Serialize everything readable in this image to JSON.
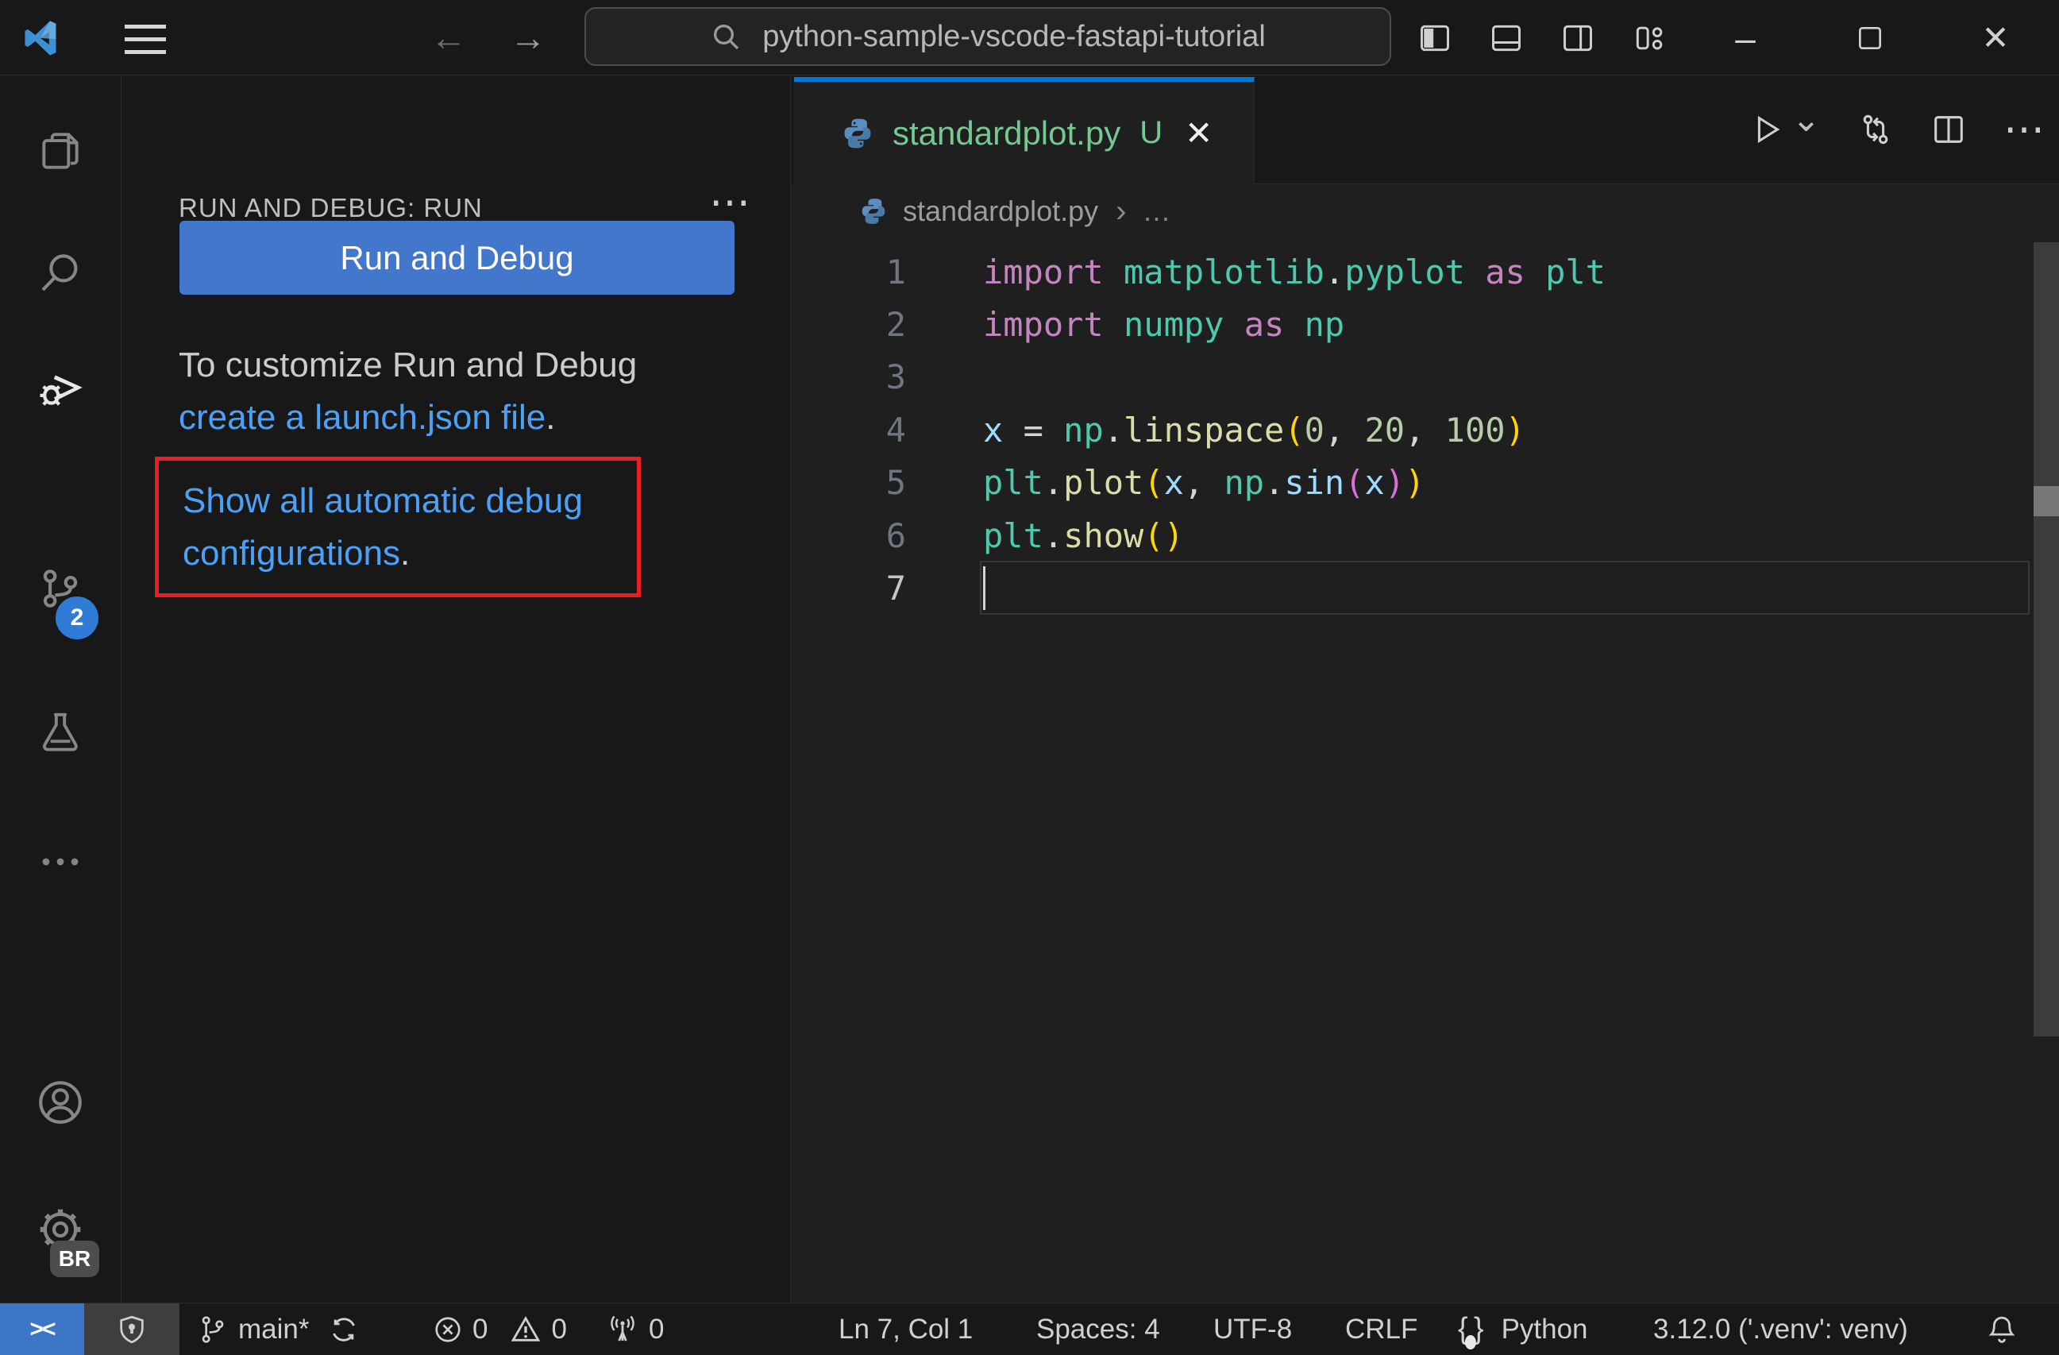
{
  "titlebar": {
    "search_value": "python-sample-vscode-fastapi-tutorial",
    "back_glyph": "←",
    "forward_glyph": "→",
    "minimize_glyph": "–",
    "close_glyph": "✕"
  },
  "activitybar": {
    "scm_badge": "2",
    "settings_badge": "BR"
  },
  "sidebar": {
    "header": "RUN AND DEBUG: RUN",
    "more_glyph": "⋯",
    "run_button": "Run and Debug",
    "hint_line1": "To customize Run and Debug",
    "hint_link": "create a launch.json file",
    "hint_period": ".",
    "box_link_line1": "Show all automatic debug",
    "box_link_line2": "configurations",
    "box_period": "."
  },
  "editor": {
    "tab": {
      "filename": "standardplot.py",
      "badge": "U",
      "close_glyph": "✕"
    },
    "toolbar": {
      "chevron_glyph": "⌄",
      "more_glyph": "⋯"
    },
    "breadcrumb": {
      "file": "standardplot.py",
      "separator": "›",
      "more": "…"
    },
    "code": {
      "active_line": 7,
      "colors": {
        "kw": "#C586C0",
        "mod": "#4EC9B0",
        "fn": "#DCDCAA",
        "var": "#9CDCFE",
        "num": "#B5CEA8",
        "pl": "#D4D4D4",
        "b1": "#FFD700",
        "b2": "#DA70D6"
      },
      "lines": [
        [
          [
            "import",
            "kw"
          ],
          [
            " ",
            "pl"
          ],
          [
            "matplotlib",
            "mod"
          ],
          [
            ".",
            "pl"
          ],
          [
            "pyplot",
            "mod"
          ],
          [
            " ",
            "pl"
          ],
          [
            "as",
            "kw"
          ],
          [
            " ",
            "pl"
          ],
          [
            "plt",
            "mod"
          ]
        ],
        [
          [
            "import",
            "kw"
          ],
          [
            " ",
            "pl"
          ],
          [
            "numpy",
            "mod"
          ],
          [
            " ",
            "pl"
          ],
          [
            "as",
            "kw"
          ],
          [
            " ",
            "pl"
          ],
          [
            "np",
            "mod"
          ]
        ],
        [],
        [
          [
            "x",
            "var"
          ],
          [
            " = ",
            "pl"
          ],
          [
            "np",
            "mod"
          ],
          [
            ".",
            "pl"
          ],
          [
            "linspace",
            "fn"
          ],
          [
            "(",
            "b1"
          ],
          [
            "0",
            "num"
          ],
          [
            ", ",
            "pl"
          ],
          [
            "20",
            "num"
          ],
          [
            ", ",
            "pl"
          ],
          [
            "100",
            "num"
          ],
          [
            ")",
            "b1"
          ]
        ],
        [
          [
            "plt",
            "mod"
          ],
          [
            ".",
            "pl"
          ],
          [
            "plot",
            "fn"
          ],
          [
            "(",
            "b1"
          ],
          [
            "x",
            "var"
          ],
          [
            ", ",
            "pl"
          ],
          [
            "np",
            "mod"
          ],
          [
            ".",
            "pl"
          ],
          [
            "sin",
            "var"
          ],
          [
            "(",
            "b2"
          ],
          [
            "x",
            "var"
          ],
          [
            ")",
            "b2"
          ],
          [
            ")",
            "b1"
          ]
        ],
        [
          [
            "plt",
            "mod"
          ],
          [
            ".",
            "pl"
          ],
          [
            "show",
            "fn"
          ],
          [
            "(",
            "b1"
          ],
          [
            ")",
            "b1"
          ]
        ],
        []
      ]
    }
  },
  "statusbar": {
    "remote_glyph": "><",
    "branch": "main*",
    "errors": "0",
    "warnings": "0",
    "ports": "0",
    "ln_col": "Ln 7, Col 1",
    "spaces": "Spaces: 4",
    "encoding": "UTF-8",
    "eol": "CRLF",
    "language": "Python",
    "interpreter": "3.12.0 ('.venv': venv)"
  },
  "colors": {
    "accent_blue": "#0078d4",
    "button_blue": "#4277cc",
    "remote_blue": "#3b76c7",
    "badge_blue": "#2f7bd6",
    "link_blue": "#4ba1f8",
    "untracked_green": "#73c991",
    "highlight_red": "#ec1c24",
    "editor_bg": "#1f1f1f",
    "chrome_bg": "#181818"
  }
}
